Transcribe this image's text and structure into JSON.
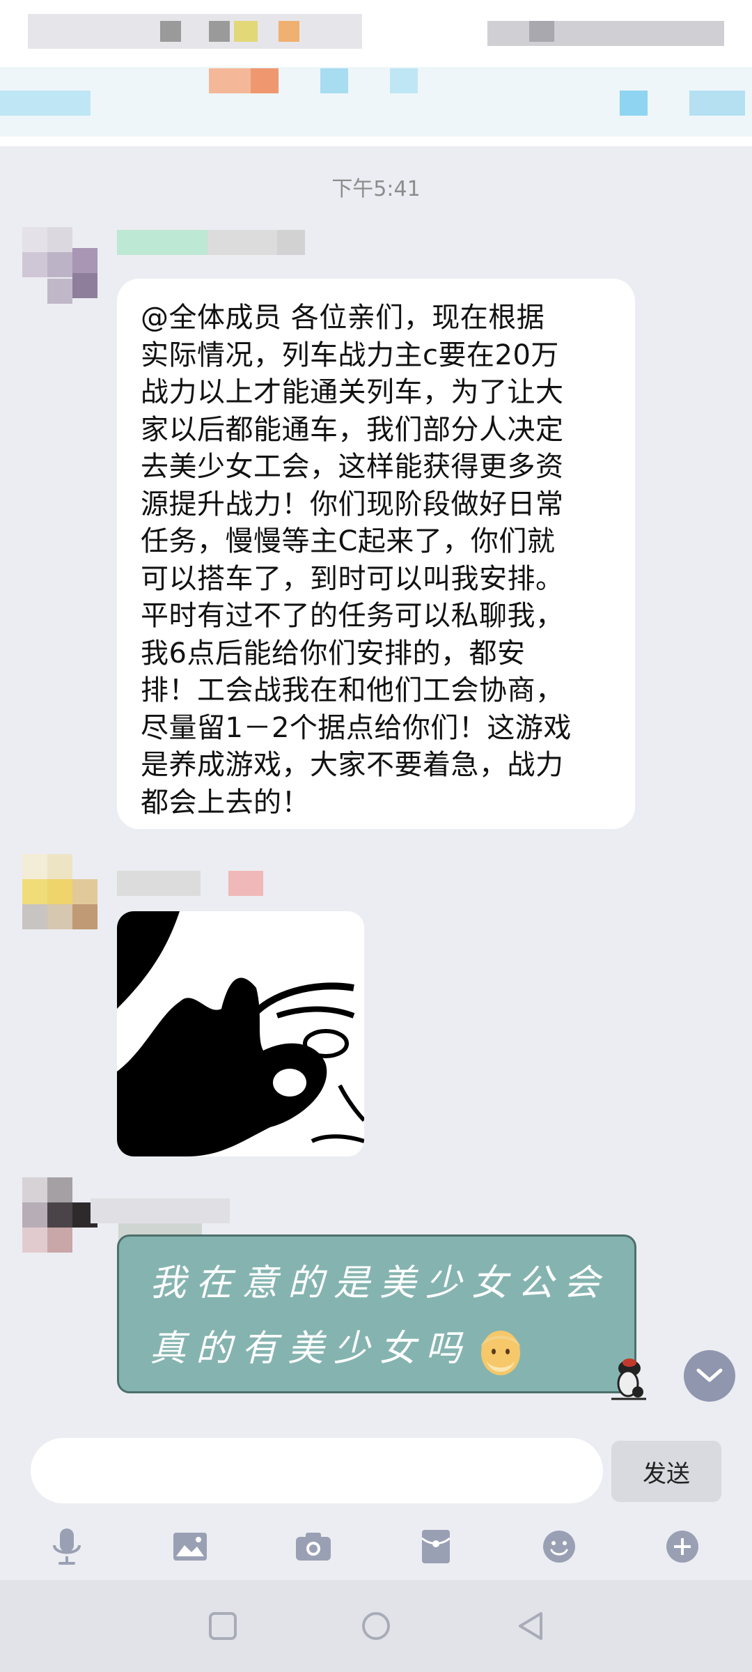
{
  "chat": {
    "timestamp": "下午5:41",
    "messages": [
      {
        "type": "text",
        "lines": [
          "@全体成员 各位亲们，现在根据",
          "实际情况，列车战力主c要在20万",
          "战力以上才能通关列车，为了让大",
          "家以后都能通车，我们部分人决定",
          "去美少女工会，这样能获得更多资",
          "源提升战力！你们现阶段做好日常",
          "任务，慢慢等主C起来了，你们就",
          "可以搭车了，到时可以叫我安排。",
          "平时有过不了的任务可以私聊我，",
          "我6点后能给你们安排的，都安",
          "排！工会战我在和他们工会协商，",
          "尽量留1－2个据点给你们！这游戏",
          "是养成游戏，大家不要着急，战力",
          "都会上去的！"
        ]
      },
      {
        "type": "sticker",
        "icon": "ok-hand-meme-sticker"
      },
      {
        "type": "styled-text",
        "line1": "我在意的是美少女公会",
        "line2": "真的有美少女吗",
        "emoji": "old-man-face-emoji"
      }
    ]
  },
  "input": {
    "value": "",
    "placeholder": ""
  },
  "send_button": {
    "label": "发送"
  },
  "toolbar": [
    "microphone-icon",
    "image-icon",
    "camera-icon",
    "red-packet-icon",
    "emoji-icon",
    "plus-icon"
  ],
  "colors": {
    "background": "#ecedf2",
    "green_bubble": "#85b4b0",
    "scroll_button": "#8f96ae"
  }
}
